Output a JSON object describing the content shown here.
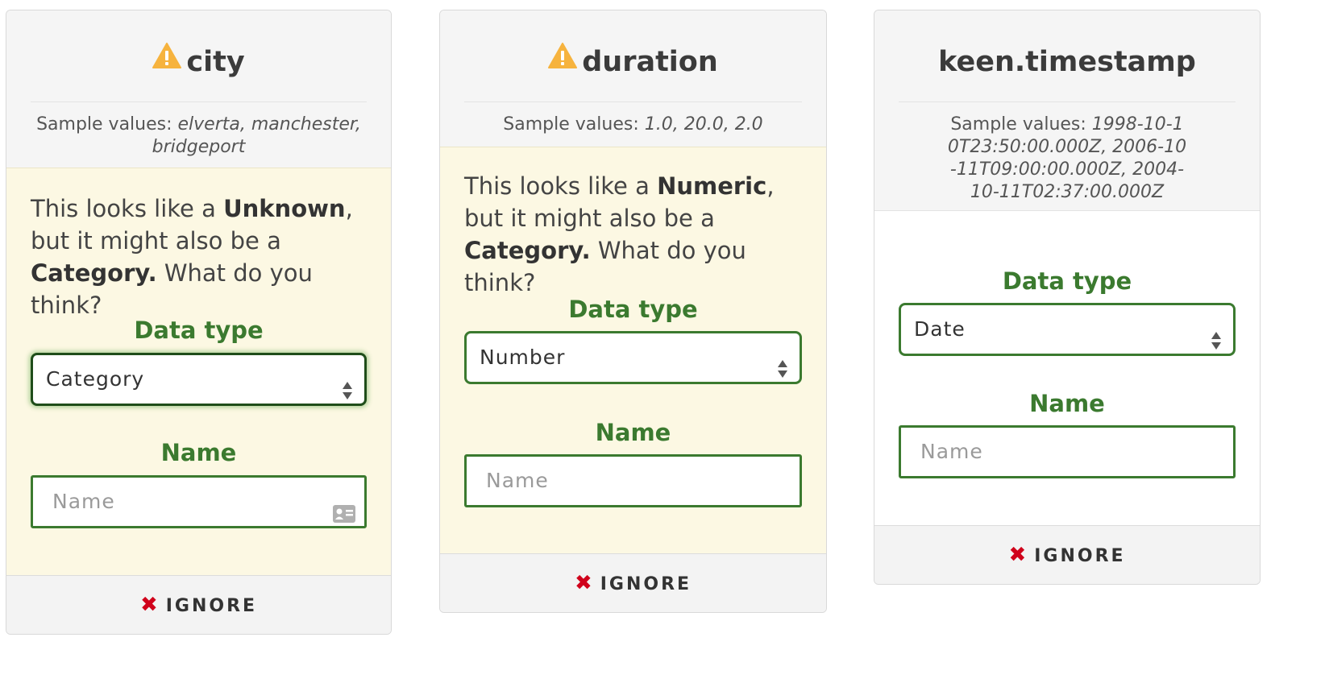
{
  "cards": [
    {
      "field_name": "city",
      "warning": true,
      "sample_label": "Sample values:",
      "sample_values": "elverta, manchester, bridgeport",
      "question": {
        "pre": "This looks like a ",
        "guess": "Unknown",
        "mid": ", but it might also be a ",
        "alt": "Category.",
        "post": " What do you think?"
      },
      "data_type_label": "Data type",
      "data_type_value": "Category",
      "name_label": "Name",
      "name_placeholder": "Name",
      "ignore_label": "IGNORE"
    },
    {
      "field_name": "duration",
      "warning": true,
      "sample_label": "Sample values:",
      "sample_values": "1.0, 20.0, 2.0",
      "question": {
        "pre": "This looks like a ",
        "guess": "Numeric",
        "mid": ", but it might also be a ",
        "alt": "Category.",
        "post": " What do you think?"
      },
      "data_type_label": "Data type",
      "data_type_value": "Number",
      "name_label": "Name",
      "name_placeholder": "Name",
      "ignore_label": "IGNORE"
    },
    {
      "field_name": "keen.timestamp",
      "warning": false,
      "sample_label": "Sample values:",
      "sample_values": "1998-10-10T23:50:00.000Z, 2006-10-11T09:00:00.000Z, 2004-10-11T02:37:00.000Z",
      "data_type_label": "Data type",
      "data_type_value": "Date",
      "name_label": "Name",
      "name_placeholder": "Name",
      "ignore_label": "IGNORE"
    }
  ],
  "colors": {
    "accent_green": "#3b7a2f",
    "warning_bg": "#fcf8e3",
    "warning_icon": "#f6b33e",
    "ignore_x": "#d0021b"
  },
  "icons": {
    "warning": "warning-triangle-icon",
    "ignore": "close-icon",
    "select": "select-arrows-icon",
    "contact": "contact-card-icon"
  }
}
